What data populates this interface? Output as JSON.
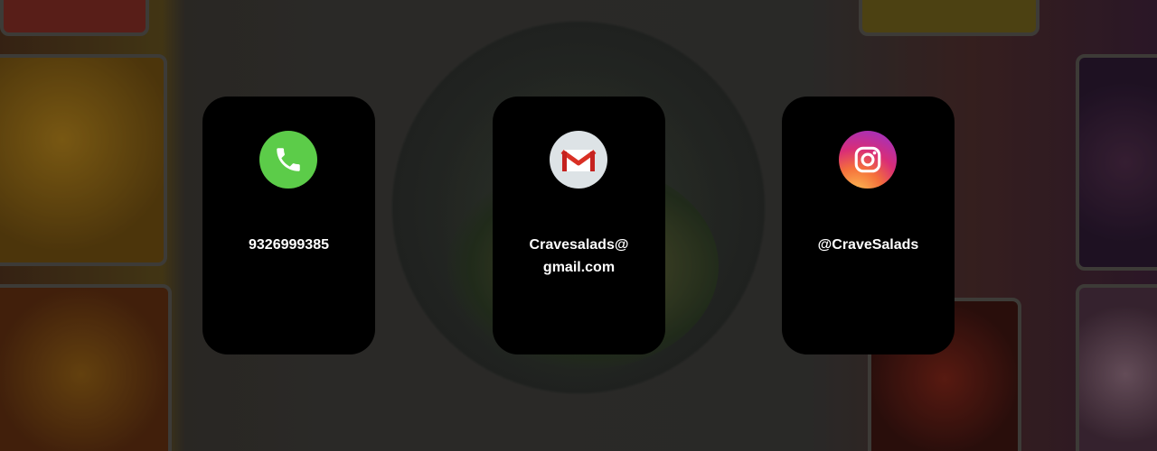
{
  "contacts": [
    {
      "icon": "phone-icon",
      "color": "#5ccc49",
      "text": "9326999385"
    },
    {
      "icon": "gmail-icon",
      "color": "#dde3e6",
      "text": "Cravesalads@\ngmail.com"
    },
    {
      "icon": "instagram-icon",
      "color": "#d92d77",
      "text": "@CraveSalads"
    }
  ]
}
